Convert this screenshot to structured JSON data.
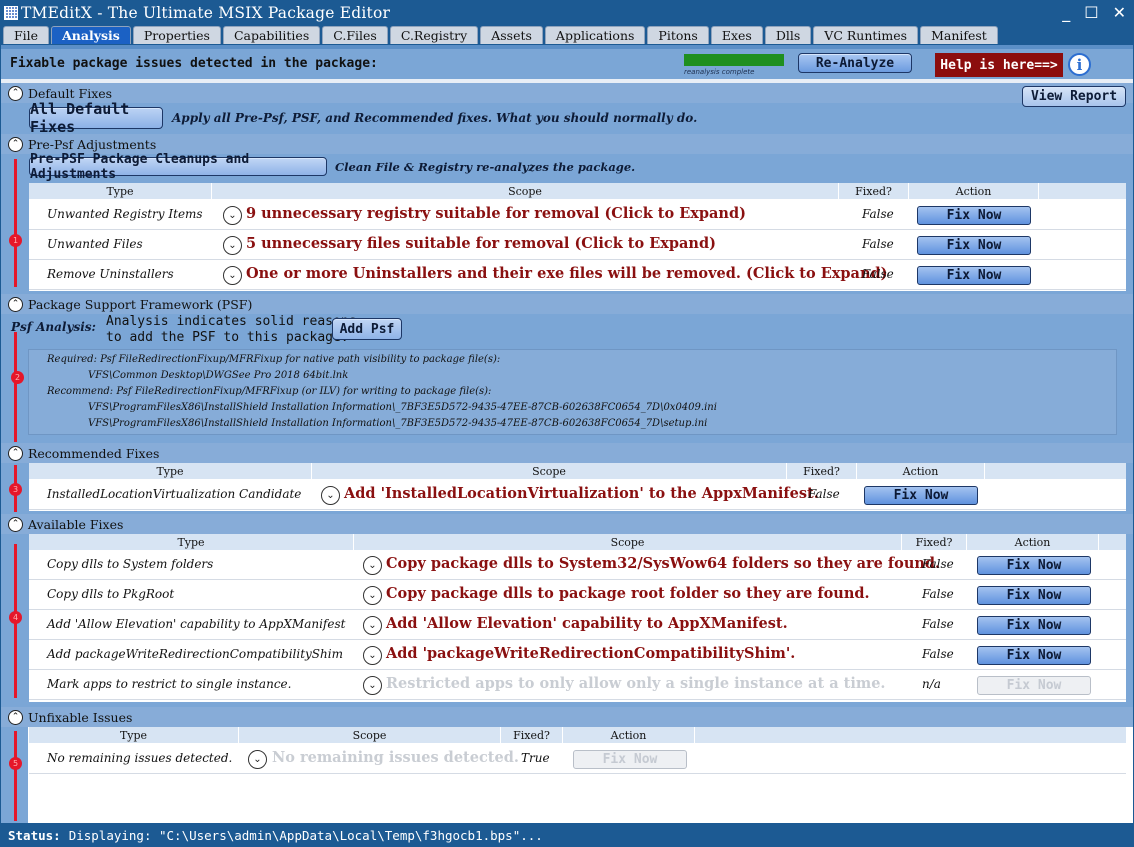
{
  "window": {
    "title": "TMEditX - The Ultimate MSIX Package Editor",
    "minimize": "_",
    "maximize": "☐",
    "close": "✕"
  },
  "tabs": [
    "File",
    "Analysis",
    "Properties",
    "Capabilities",
    "C.Files",
    "C.Registry",
    "Assets",
    "Applications",
    "Pitons",
    "Exes",
    "Dlls",
    "VC Runtimes",
    "Manifest"
  ],
  "active_tab": "Analysis",
  "topbar": {
    "label": "Fixable package issues detected in the package:",
    "progress_text": "reanalysis complete",
    "progress": 1.0,
    "reanalyze": "Re-Analyze",
    "help": "Help is here==>",
    "info": "i"
  },
  "default_fixes": {
    "header": "Default Fixes",
    "button": "All Default Fixes",
    "desc": "Apply all Pre-Psf, PSF, and Recommended fixes.  What you should normally do.",
    "view_report": "View Report"
  },
  "pre_psf": {
    "header": "Pre-Psf Adjustments",
    "button": "Pre-PSF Package Cleanups and Adjustments",
    "desc": "Clean File & Registry re-analyzes the package.",
    "marker": "1",
    "columns": [
      "Type",
      "Scope",
      "Fixed?",
      "Action"
    ],
    "rows": [
      {
        "type": "Unwanted Registry Items",
        "scope": "9 unnecessary registry suitable for removal (Click to Expand)",
        "fixed": "False",
        "action": "Fix Now"
      },
      {
        "type": "Unwanted Files",
        "scope": "5 unnecessary files suitable for removal (Click to Expand)",
        "fixed": "False",
        "action": "Fix Now"
      },
      {
        "type": "Remove Uninstallers",
        "scope": "One or more Uninstallers and their exe files will be removed. (Click to Expand)",
        "fixed": "False",
        "action": "Fix Now"
      }
    ]
  },
  "psf": {
    "header": "Package Support Framework (PSF)",
    "label": "Psf Analysis:",
    "analysis_line1": "Analysis indicates solid reasons",
    "analysis_line2": "to add the PSF to this package.",
    "button": "Add Psf",
    "marker": "2",
    "lines": [
      "Required: Psf FileRedirectionFixup/MFRFixup for native path visibility to package file(s):",
      "VFS\\Common Desktop\\DWGSee Pro 2018 64bit.lnk",
      "Recommend: Psf FileRedirectionFixup/MFRFixup (or ILV) for writing to package file(s):",
      "VFS\\ProgramFilesX86\\InstallShield Installation Information\\_7BF3E5D572-9435-47EE-87CB-602638FC0654_7D\\0x0409.ini",
      "VFS\\ProgramFilesX86\\InstallShield Installation Information\\_7BF3E5D572-9435-47EE-87CB-602638FC0654_7D\\setup.ini"
    ]
  },
  "recommended": {
    "header": "Recommended Fixes",
    "marker": "3",
    "columns": [
      "Type",
      "Scope",
      "Fixed?",
      "Action"
    ],
    "rows": [
      {
        "type": "InstalledLocationVirtualization Candidate",
        "scope": "Add 'InstalledLocationVirtualization' to the AppxManifest.",
        "fixed": "False",
        "action": "Fix Now"
      }
    ]
  },
  "available": {
    "header": "Available Fixes",
    "marker": "4",
    "columns": [
      "Type",
      "Scope",
      "Fixed?",
      "Action"
    ],
    "rows": [
      {
        "type": "Copy dlls to System folders",
        "scope": "Copy package dlls to System32/SysWow64 folders so they are found.",
        "fixed": "False",
        "action": "Fix Now"
      },
      {
        "type": "Copy dlls to PkgRoot",
        "scope": "Copy package dlls to package root folder so they are found.",
        "fixed": "False",
        "action": "Fix Now"
      },
      {
        "type": "Add 'Allow Elevation' capability to AppXManifest",
        "scope": "Add 'Allow Elevation' capability to AppXManifest.",
        "fixed": "False",
        "action": "Fix Now"
      },
      {
        "type": "Add packageWriteRedirectionCompatibilityShim",
        "scope": "Add 'packageWriteRedirectionCompatibilityShim'.",
        "fixed": "False",
        "action": "Fix Now"
      },
      {
        "type": "Mark apps to restrict to single instance.",
        "scope": "Restricted apps to only allow only a single instance at a time.",
        "fixed": "n/a",
        "action": "Fix Now"
      }
    ]
  },
  "unfixable": {
    "header": "Unfixable Issues",
    "marker": "5",
    "columns": [
      "Type",
      "Scope",
      "Fixed?",
      "Action"
    ],
    "rows": [
      {
        "type": "No remaining issues detected.",
        "scope": "No remaining issues detected.",
        "fixed": "True",
        "action": "Fix Now"
      }
    ]
  },
  "status": {
    "label": "Status:",
    "text": "Displaying: \"C:\\Users\\admin\\AppData\\Local\\Temp\\f3hgocb1.bps\"..."
  },
  "icons": {
    "collapse": "chevron-up-icon",
    "expand": "chevron-down-icon",
    "app": "grid-app-icon",
    "info": "info-icon"
  }
}
